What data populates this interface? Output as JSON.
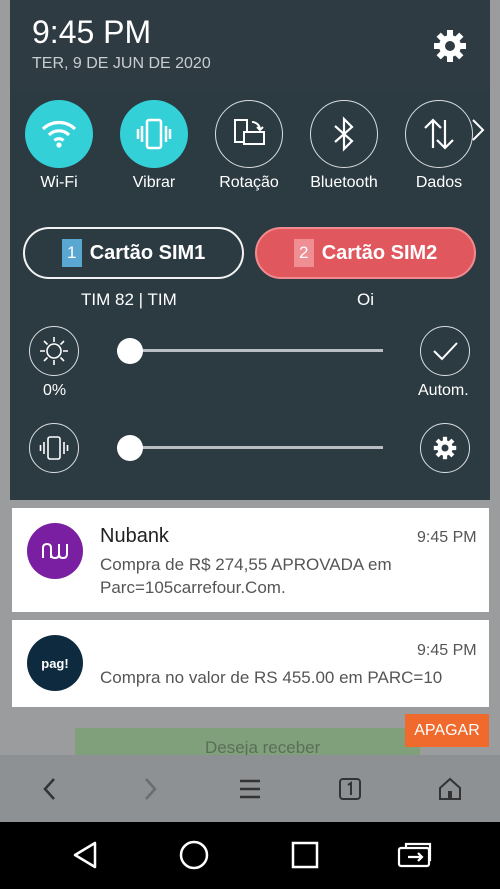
{
  "status": {
    "time": "9:45 PM",
    "date": "TER, 9 DE JUN DE 2020"
  },
  "quick_settings": [
    {
      "label": "Wi-Fi",
      "icon": "wifi-icon",
      "active": true
    },
    {
      "label": "Vibrar",
      "icon": "vibrate-icon",
      "active": true
    },
    {
      "label": "Rotação",
      "icon": "rotation-icon",
      "active": false
    },
    {
      "label": "Bluetooth",
      "icon": "bluetooth-icon",
      "active": false
    },
    {
      "label": "Dados",
      "icon": "data-icon",
      "active": false
    }
  ],
  "sim": {
    "sim1": {
      "number": "1",
      "label": "Cartão SIM1",
      "carrier": "TIM 82 | TIM"
    },
    "sim2": {
      "number": "2",
      "label": "Cartão SIM2",
      "carrier": "Oi"
    }
  },
  "brightness": {
    "value_label": "0%",
    "auto_label": "Autom.",
    "level": 0
  },
  "volume": {
    "level": 0
  },
  "notifications": [
    {
      "app": "Nubank",
      "time": "9:45 PM",
      "body_line1": "Compra de R$ 274,55 APROVADA em",
      "body_line2": "Parc=105carrefour.Com.",
      "icon_color": "#7b1fa2"
    },
    {
      "app_icon_text": "pag!",
      "time": "9:45 PM",
      "body": "Compra no valor de RS 455.00 em PARC=10",
      "icon_color": "#0d2a3f"
    }
  ],
  "clear_all_label": "APAGAR",
  "background": {
    "banner_text": "Deseja receber"
  },
  "colors": {
    "accent": "#34d0d8",
    "sim2": "#e0575d",
    "clear_button": "#ef6a2c"
  }
}
